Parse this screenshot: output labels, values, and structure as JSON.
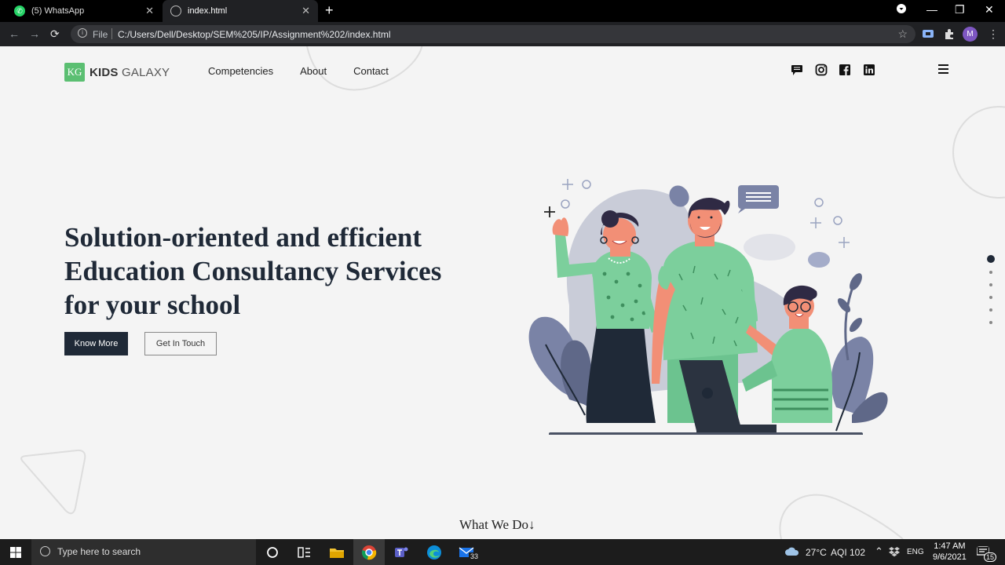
{
  "browser": {
    "tabs": [
      {
        "title": "(5) WhatsApp"
      },
      {
        "title": "index.html"
      }
    ],
    "address": {
      "scheme_label": "File",
      "url": "C:/Users/Dell/Desktop/SEM%205/IP/Assignment%202/index.html"
    },
    "profile_initial": "M"
  },
  "site": {
    "logo": {
      "badge": "KG",
      "word1": "KIDS",
      "word2": "GALAXY"
    },
    "nav": [
      "Competencies",
      "About",
      "Contact"
    ],
    "social_icons": [
      "chat-icon",
      "instagram-icon",
      "facebook-icon",
      "linkedin-icon"
    ],
    "hero": {
      "line1": "Solution-oriented and efficient",
      "line2": "Education Consultancy Services",
      "line3": "for your school",
      "primary_button": "Know More",
      "secondary_button": "Get In Touch"
    },
    "section_link": "What We Do",
    "section_arrow": "↓",
    "slide_count": 6,
    "active_slide": 1,
    "colors": {
      "primary": "#1f2937",
      "accent_green": "#5bbf72",
      "illustration_green": "#7ccf9c",
      "illustration_gray": "#7a83a6"
    }
  },
  "taskbar": {
    "search_placeholder": "Type here to search",
    "weather": "27°C",
    "aqi": "AQI 102",
    "language": "ENG",
    "time": "1:47 AM",
    "date": "9/6/2021",
    "mail_badge": "33",
    "notification_badge": "15"
  }
}
